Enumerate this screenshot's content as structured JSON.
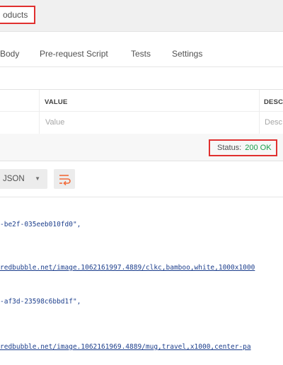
{
  "tab": {
    "title": "oducts"
  },
  "request_tabs": [
    "Body",
    "Pre-request Script",
    "Tests",
    "Settings"
  ],
  "params_table": {
    "columns": [
      "VALUE",
      "DESCR"
    ],
    "placeholders": {
      "value": "Value",
      "description": "Desc"
    }
  },
  "response": {
    "status_label": "Status:",
    "status_value": "200 OK",
    "format": "JSON",
    "status_color": "#1a9e4a"
  },
  "code_lines": [
    "-be2f-035eeb010fd0\",",
    "redbubble.net/image.1062161997.4889/clkc,bamboo,white,1000x1000",
    "-af3d-23598c6bbd1f\",",
    "redbubble.net/image.1062161969.4889/mug,travel,x1000,center-pa"
  ],
  "icons": {
    "format_caret": "chevron-down-icon",
    "wrap": "wrap-lines-icon"
  }
}
